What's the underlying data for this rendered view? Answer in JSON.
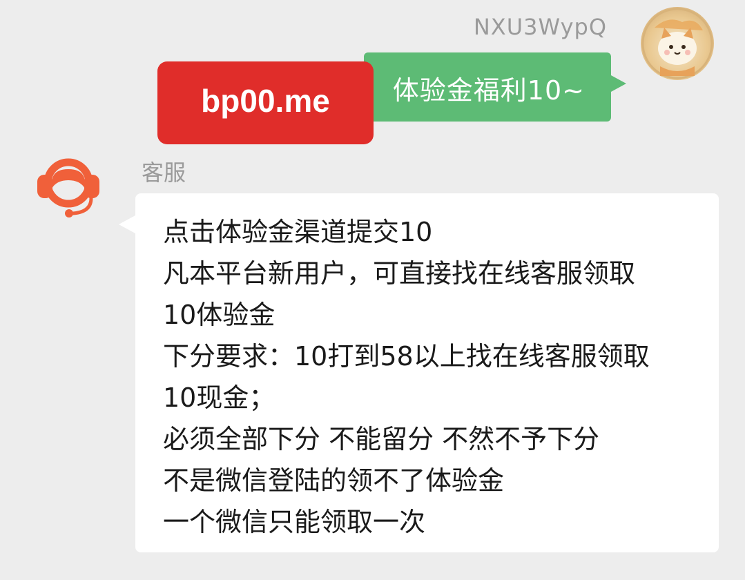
{
  "outgoing": {
    "sender_name": "NXU3WypQ",
    "message": "体验金福利10~",
    "overlay_label": "bp00.me"
  },
  "incoming": {
    "sender_name": "客服",
    "lines": [
      "点击体验金渠道提交10",
      "凡本平台新用户，可直接找在线客服领取",
      "10体验金",
      "下分要求：10打到58以上找在线客服领取",
      "10现金；",
      "必须全部下分 不能留分 不然不予下分",
      "不是微信登陆的领不了体验金",
      "一个微信只能领取一次"
    ]
  },
  "colors": {
    "background": "#ededed",
    "outgoing_bubble": "#5dbb75",
    "incoming_bubble": "#ffffff",
    "overlay_label": "#e02d2a",
    "service_avatar": "#f0603a"
  },
  "icons": {
    "user_avatar": "cartoon-cat-avatar",
    "service_avatar": "headset-agent-icon"
  }
}
